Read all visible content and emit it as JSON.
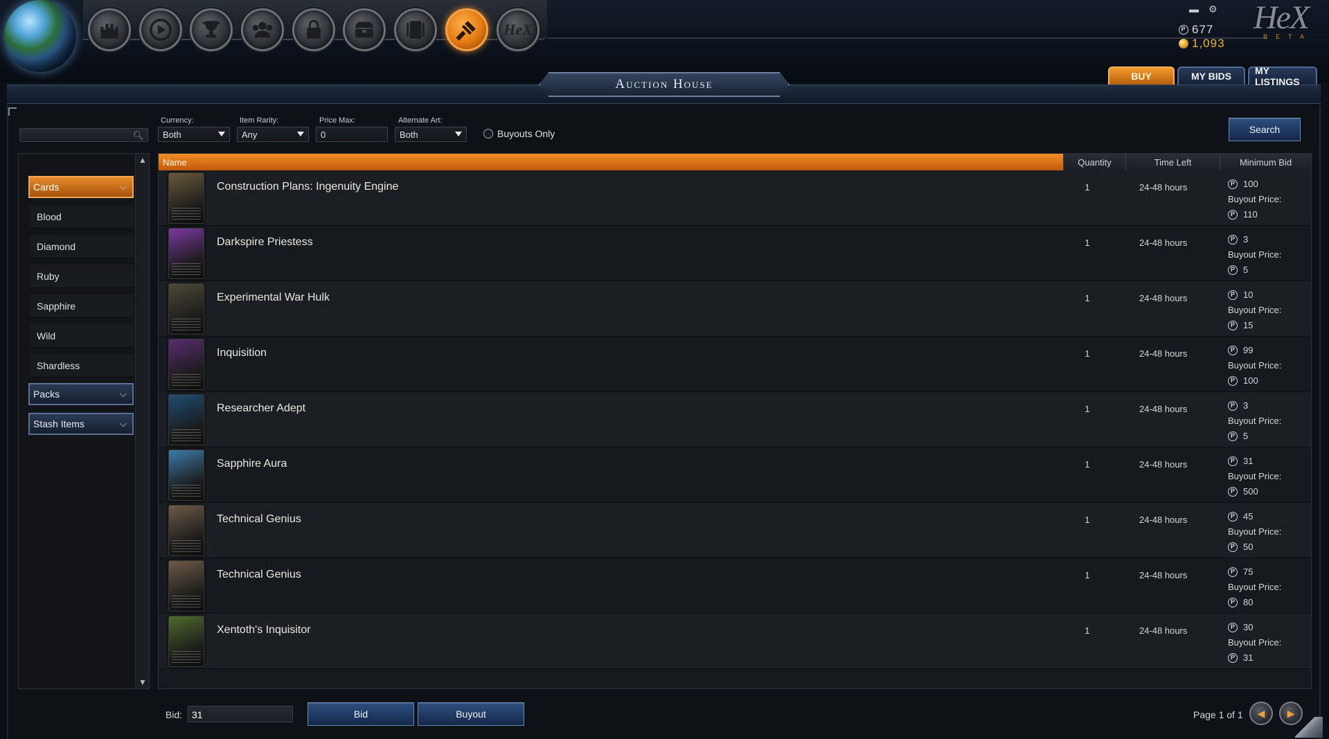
{
  "app": {
    "title": "Auction House",
    "logo_text": "HeX",
    "logo_sub": "BETA"
  },
  "nav": {
    "buttons": [
      {
        "icon": "castle-icon"
      },
      {
        "icon": "play-icon"
      },
      {
        "icon": "trophy-icon"
      },
      {
        "icon": "friends-icon"
      },
      {
        "icon": "lock-icon"
      },
      {
        "icon": "chest-icon"
      },
      {
        "icon": "card-collection-icon"
      },
      {
        "icon": "auction-hammer-icon"
      },
      {
        "icon": "hex-store-icon"
      }
    ],
    "hex_label": "HeX",
    "active_index": 7
  },
  "currency": {
    "platinum": "677",
    "gold": "1,093",
    "plat_symbol": "P"
  },
  "tabs": {
    "buy": "BUY",
    "my_bids": "MY BIDS",
    "my_listings": "MY LISTINGS",
    "active": "buy"
  },
  "filters": {
    "search_value": "",
    "currency_label": "Currency:",
    "currency_value": "Both",
    "rarity_label": "Item Rarity:",
    "rarity_value": "Any",
    "price_label": "Price Max:",
    "price_value": "0",
    "alt_art_label": "Alternate Art:",
    "alt_art_value": "Both",
    "buyouts_only_label": "Buyouts Only",
    "buyouts_only_checked": false,
    "search_button": "Search"
  },
  "sidebar": {
    "cards_label": "Cards",
    "items": [
      "Blood",
      "Diamond",
      "Ruby",
      "Sapphire",
      "Wild",
      "Shardless"
    ],
    "packs_label": "Packs",
    "stash_label": "Stash Items"
  },
  "table": {
    "columns": {
      "name": "Name",
      "quantity": "Quantity",
      "time_left": "Time Left",
      "min_bid": "Minimum Bid"
    },
    "buyout_label": "Buyout Price:",
    "rows": [
      {
        "name": "Construction Plans: Ingenuity Engine",
        "quantity": "1",
        "time_left": "24-48 hours",
        "min_bid": "100",
        "buyout": "110",
        "art": "#6b5a3c"
      },
      {
        "name": "Darkspire Priestess",
        "quantity": "1",
        "time_left": "24-48 hours",
        "min_bid": "3",
        "buyout": "5",
        "art": "#7a3aa0"
      },
      {
        "name": "Experimental War Hulk",
        "quantity": "1",
        "time_left": "24-48 hours",
        "min_bid": "10",
        "buyout": "15",
        "art": "#4d4a38"
      },
      {
        "name": "Inquisition",
        "quantity": "1",
        "time_left": "24-48 hours",
        "min_bid": "99",
        "buyout": "100",
        "art": "#5a2d70"
      },
      {
        "name": "Researcher Adept",
        "quantity": "1",
        "time_left": "24-48 hours",
        "min_bid": "3",
        "buyout": "5",
        "art": "#1f4c72"
      },
      {
        "name": "Sapphire Aura",
        "quantity": "1",
        "time_left": "24-48 hours",
        "min_bid": "31",
        "buyout": "500",
        "art": "#3c7aa8"
      },
      {
        "name": "Technical Genius",
        "quantity": "1",
        "time_left": "24-48 hours",
        "min_bid": "45",
        "buyout": "50",
        "art": "#6e5a48"
      },
      {
        "name": "Technical Genius",
        "quantity": "1",
        "time_left": "24-48 hours",
        "min_bid": "75",
        "buyout": "80",
        "art": "#6e5a48"
      },
      {
        "name": "Xentoth's Inquisitor",
        "quantity": "1",
        "time_left": "24-48 hours",
        "min_bid": "30",
        "buyout": "31",
        "art": "#4f6a2c"
      }
    ]
  },
  "footer": {
    "bid_label": "Bid:",
    "bid_value": "31",
    "bid_button": "Bid",
    "buyout_button": "Buyout",
    "page_text": "Page 1 of 1"
  },
  "colors": {
    "accent_orange": "#ef8f26",
    "button_blue": "#2d4e7e",
    "gold": "#e8b43c"
  }
}
